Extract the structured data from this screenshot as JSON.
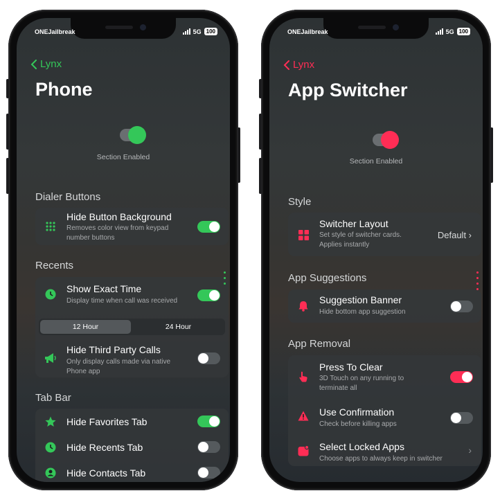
{
  "colors": {
    "green": "#34c759",
    "pink": "#ff2d55"
  },
  "left": {
    "status": {
      "carrier": "ONEJailbreak",
      "network": "5G",
      "battery": "100"
    },
    "back_label": "Lynx",
    "title": "Phone",
    "section_enabled": "Section Enabled",
    "sections": {
      "dialer": "Dialer Buttons",
      "recents": "Recents",
      "tabbar": "Tab Bar"
    },
    "rows": {
      "hide_bg": {
        "title": "Hide Button Background",
        "subtitle": "Removes color view from keypad number buttons",
        "icon": "keypad-icon",
        "on": true
      },
      "exact_time": {
        "title": "Show Exact Time",
        "subtitle": "Display time when call was received",
        "icon": "clock-icon",
        "on": true
      },
      "third_party": {
        "title": "Hide Third Party Calls",
        "subtitle": "Only display calls made via native Phone app",
        "icon": "megaphone-icon",
        "on": false
      },
      "favorites": {
        "title": "Hide Favorites Tab",
        "icon": "star-icon",
        "on": true
      },
      "recents_tab": {
        "title": "Hide Recents Tab",
        "icon": "clock-icon",
        "on": false
      },
      "contacts": {
        "title": "Hide Contacts Tab",
        "icon": "person-icon",
        "on": false
      }
    },
    "segment": {
      "option1": "12 Hour",
      "option2": "24 Hour",
      "selected": "12 Hour"
    }
  },
  "right": {
    "status": {
      "carrier": "ONEJailbreak",
      "network": "5G",
      "battery": "100"
    },
    "back_label": "Lynx",
    "title": "App Switcher",
    "section_enabled": "Section Enabled",
    "sections": {
      "style": "Style",
      "suggestions": "App Suggestions",
      "removal": "App Removal"
    },
    "rows": {
      "layout": {
        "title": "Switcher Layout",
        "subtitle": "Set style of switcher cards. Applies instantly",
        "value": "Default ›",
        "icon": "grid-icon"
      },
      "banner": {
        "title": "Suggestion Banner",
        "subtitle": "Hide bottom app suggestion",
        "icon": "bell-icon",
        "on": false
      },
      "press": {
        "title": "Press To Clear",
        "subtitle": "3D Touch on any running to terminate all",
        "icon": "hand-pointer-icon",
        "on": true
      },
      "confirm": {
        "title": "Use Confirmation",
        "subtitle": "Check before killing apps",
        "icon": "warning-icon",
        "on": false
      },
      "locked": {
        "title": "Select Locked Apps",
        "subtitle": "Choose apps to always keep in switcher",
        "icon": "lock-app-icon",
        "chevron": "›"
      }
    }
  }
}
